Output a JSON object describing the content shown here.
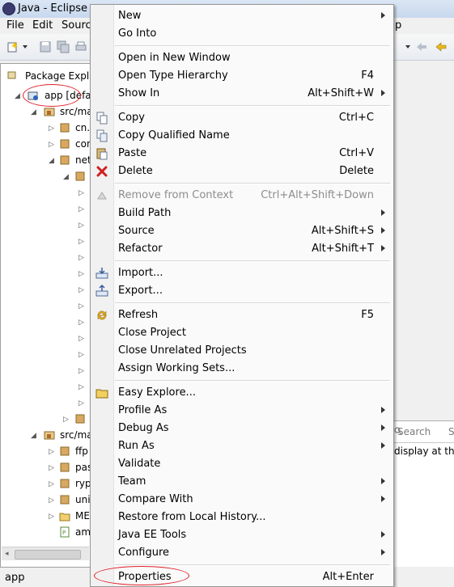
{
  "window": {
    "title": "Java - Eclipse"
  },
  "menubar": [
    {
      "label": "File"
    },
    {
      "label": "Edit"
    },
    {
      "label": "Sourc"
    },
    {
      "label": "p"
    }
  ],
  "package_explorer": {
    "tab_label": "Package Explor",
    "rows": [
      {
        "label": "app [defa"
      },
      {
        "label": "src/ma"
      },
      {
        "label": "cn."
      },
      {
        "label": "con"
      },
      {
        "label": "net"
      },
      {
        "label": "src/ma"
      },
      {
        "label": "ffp"
      },
      {
        "label": "pas"
      },
      {
        "label": "ryp"
      },
      {
        "label": "uni"
      },
      {
        "label": "ME"
      },
      {
        "label": "am"
      }
    ]
  },
  "right_panel": {
    "search_label": "Search",
    "search_suffix": "S",
    "text": "display at thi"
  },
  "status_bar": {
    "text": "app"
  },
  "context_menu": {
    "items": [
      {
        "label": "New",
        "shortcut": "",
        "submenu": true
      },
      {
        "label": "Go Into",
        "shortcut": "",
        "submenu": false
      },
      {
        "label": "Open in New Window",
        "shortcut": "",
        "submenu": false
      },
      {
        "label": "Open Type Hierarchy",
        "shortcut": "F4",
        "submenu": false
      },
      {
        "label": "Show In",
        "shortcut": "Alt+Shift+W",
        "submenu": true
      },
      {
        "label": "Copy",
        "shortcut": "Ctrl+C",
        "submenu": false,
        "icon": "copy-icon"
      },
      {
        "label": "Copy Qualified Name",
        "shortcut": "",
        "submenu": false,
        "icon": "copy-qualified-name-icon"
      },
      {
        "label": "Paste",
        "shortcut": "Ctrl+V",
        "submenu": false,
        "icon": "paste-icon"
      },
      {
        "label": "Delete",
        "shortcut": "Delete",
        "submenu": false,
        "icon": "delete-icon"
      },
      {
        "label": "Remove from Context",
        "shortcut": "Ctrl+Alt+Shift+Down",
        "submenu": false,
        "disabled": true,
        "icon": "remove-from-context-icon"
      },
      {
        "label": "Build Path",
        "shortcut": "",
        "submenu": true
      },
      {
        "label": "Source",
        "shortcut": "Alt+Shift+S",
        "submenu": true
      },
      {
        "label": "Refactor",
        "shortcut": "Alt+Shift+T",
        "submenu": true
      },
      {
        "label": "Import...",
        "shortcut": "",
        "submenu": false,
        "icon": "import-icon"
      },
      {
        "label": "Export...",
        "shortcut": "",
        "submenu": false,
        "icon": "export-icon"
      },
      {
        "label": "Refresh",
        "shortcut": "F5",
        "submenu": false,
        "icon": "refresh-icon"
      },
      {
        "label": "Close Project",
        "shortcut": "",
        "submenu": false
      },
      {
        "label": "Close Unrelated Projects",
        "shortcut": "",
        "submenu": false
      },
      {
        "label": "Assign Working Sets...",
        "shortcut": "",
        "submenu": false
      },
      {
        "label": "Easy Explore...",
        "shortcut": "",
        "submenu": false,
        "icon": "folder-icon"
      },
      {
        "label": "Profile As",
        "shortcut": "",
        "submenu": true
      },
      {
        "label": "Debug As",
        "shortcut": "",
        "submenu": true
      },
      {
        "label": "Run As",
        "shortcut": "",
        "submenu": true
      },
      {
        "label": "Validate",
        "shortcut": "",
        "submenu": false
      },
      {
        "label": "Team",
        "shortcut": "",
        "submenu": true
      },
      {
        "label": "Compare With",
        "shortcut": "",
        "submenu": true
      },
      {
        "label": "Restore from Local History...",
        "shortcut": "",
        "submenu": false
      },
      {
        "label": "Java EE Tools",
        "shortcut": "",
        "submenu": true
      },
      {
        "label": "Configure",
        "shortcut": "",
        "submenu": true
      },
      {
        "label": "Properties",
        "shortcut": "Alt+Enter",
        "submenu": false
      }
    ]
  },
  "colors": {
    "annotation_red": "#e0202a",
    "menu_bg": "#fafafa",
    "accent_blue": "#3c5f9e"
  }
}
